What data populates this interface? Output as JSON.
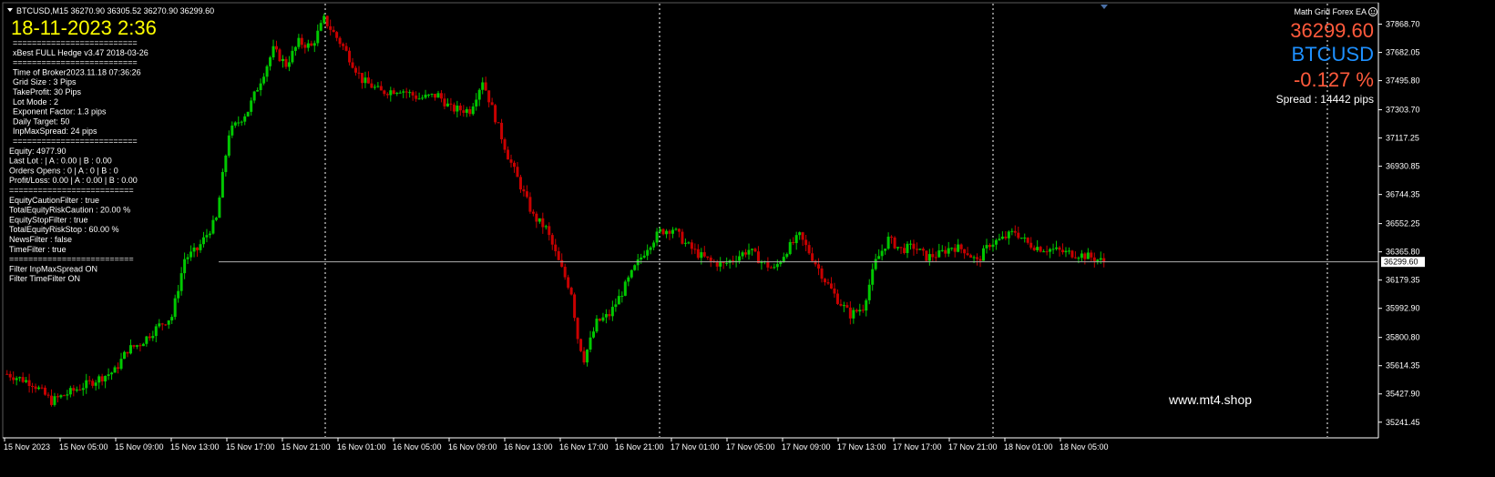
{
  "header": {
    "symbol_line": "BTCUSD,M15  36270.90 36305.52 36270.90 36299.60",
    "datetime": "18-11-2023 2:36",
    "ea_name": "Math Grid Forex EA"
  },
  "info_panel": {
    "lines": [
      "==========================",
      "xBest FULL Hedge v3.47 2018-03-26",
      "==========================",
      "Time of Broker2023.11.18 07:36:26",
      "Grid Size : 3 Pips",
      "TakeProfit: 30 Pips",
      "Lot Mode : 2",
      "Exponent Factor: 1.3 pips",
      "Daily Target: 50",
      "InpMaxSpread: 24 pips",
      "==========================",
      "Equity:      4977.90",
      "Last Lot : | A : 0.00 | B : 0.00",
      "Orders Opens :   0 | A : 0 | B : 0",
      "Profit/Loss: 0.00 | A : 0.00 | B : 0.00",
      "==========================",
      "EquityCautionFilter : true",
      "TotalEquityRiskCaution : 20.00 %",
      "EquityStopFilter : true",
      "TotalEquityRiskStop : 60.00 %",
      "NewsFilter : false",
      "TimeFilter : true",
      "==========================",
      "Filter InpMaxSpread ON",
      "Filter TimeFilter ON"
    ]
  },
  "quote_panel": {
    "price": "36299.60",
    "symbol": "BTCUSD",
    "change": "-0.127 %",
    "spread": "Spread : 14442 pips"
  },
  "watermark": "www.mt4.shop",
  "current_price_label": "36299.60",
  "colors": {
    "bull": "#00c800",
    "bear": "#c80000",
    "price_big": "#ff5a3c",
    "symbol": "#1e90ff",
    "date": "#ffff00"
  },
  "chart_data": {
    "type": "candlestick",
    "timeframe": "M15",
    "y_ticks": [
      "37868.70",
      "37682.05",
      "37495.80",
      "37303.70",
      "37117.25",
      "36930.85",
      "36744.35",
      "36552.25",
      "36365.80",
      "36179.35",
      "35992.90",
      "35800.80",
      "35614.35",
      "35427.90",
      "35241.45"
    ],
    "x_ticks": [
      "15 Nov 2023",
      "15 Nov 05:00",
      "15 Nov 09:00",
      "15 Nov 13:00",
      "15 Nov 17:00",
      "15 Nov 21:00",
      "16 Nov 01:00",
      "16 Nov 05:00",
      "16 Nov 09:00",
      "16 Nov 13:00",
      "16 Nov 17:00",
      "16 Nov 21:00",
      "17 Nov 01:00",
      "17 Nov 05:00",
      "17 Nov 09:00",
      "17 Nov 13:00",
      "17 Nov 17:00",
      "17 Nov 21:00",
      "18 Nov 01:00",
      "18 Nov 05:00"
    ],
    "ylim": [
      35180,
      37920
    ],
    "current_price": 36299.6,
    "path_points": [
      [
        0,
        35560
      ],
      [
        8,
        35500
      ],
      [
        14,
        35380
      ],
      [
        20,
        35440
      ],
      [
        28,
        35520
      ],
      [
        34,
        35580
      ],
      [
        38,
        35720
      ],
      [
        42,
        35760
      ],
      [
        48,
        35880
      ],
      [
        52,
        35940
      ],
      [
        56,
        36320
      ],
      [
        60,
        36380
      ],
      [
        66,
        36580
      ],
      [
        70,
        37150
      ],
      [
        76,
        37300
      ],
      [
        80,
        37500
      ],
      [
        84,
        37700
      ],
      [
        88,
        37600
      ],
      [
        92,
        37750
      ],
      [
        96,
        37720
      ],
      [
        100,
        37900
      ],
      [
        106,
        37720
      ],
      [
        112,
        37500
      ],
      [
        118,
        37420
      ],
      [
        124,
        37440
      ],
      [
        130,
        37380
      ],
      [
        136,
        37400
      ],
      [
        140,
        37310
      ],
      [
        146,
        37300
      ],
      [
        150,
        37500
      ],
      [
        154,
        37250
      ],
      [
        158,
        37000
      ],
      [
        162,
        36800
      ],
      [
        166,
        36600
      ],
      [
        170,
        36520
      ],
      [
        174,
        36300
      ],
      [
        178,
        36100
      ],
      [
        180,
        35800
      ],
      [
        182,
        35660
      ],
      [
        186,
        35900
      ],
      [
        190,
        35950
      ],
      [
        194,
        36100
      ],
      [
        198,
        36260
      ],
      [
        202,
        36400
      ],
      [
        206,
        36500
      ],
      [
        210,
        36520
      ],
      [
        214,
        36420
      ],
      [
        218,
        36350
      ],
      [
        222,
        36300
      ],
      [
        226,
        36280
      ],
      [
        230,
        36330
      ],
      [
        234,
        36380
      ],
      [
        238,
        36300
      ],
      [
        242,
        36250
      ],
      [
        246,
        36380
      ],
      [
        250,
        36470
      ],
      [
        254,
        36330
      ],
      [
        258,
        36180
      ],
      [
        262,
        36050
      ],
      [
        266,
        35950
      ],
      [
        270,
        36000
      ],
      [
        274,
        36300
      ],
      [
        278,
        36450
      ],
      [
        282,
        36380
      ],
      [
        286,
        36400
      ],
      [
        290,
        36330
      ],
      [
        294,
        36350
      ],
      [
        298,
        36400
      ],
      [
        302,
        36380
      ],
      [
        306,
        36300
      ],
      [
        310,
        36420
      ],
      [
        314,
        36450
      ],
      [
        318,
        36500
      ],
      [
        322,
        36420
      ],
      [
        326,
        36390
      ],
      [
        330,
        36380
      ],
      [
        334,
        36360
      ],
      [
        338,
        36350
      ],
      [
        342,
        36330
      ],
      [
        346,
        36300
      ]
    ]
  }
}
